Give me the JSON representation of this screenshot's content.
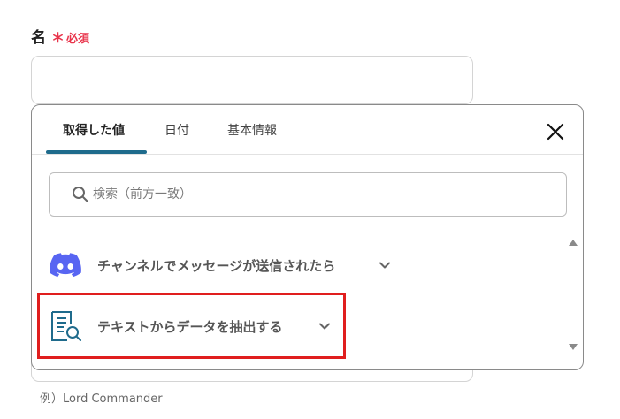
{
  "field": {
    "label": "名",
    "required_star": "＊",
    "required_text": "必須",
    "input_value": ""
  },
  "popup": {
    "tabs": [
      {
        "label": "取得した値",
        "active": true
      },
      {
        "label": "日付",
        "active": false
      },
      {
        "label": "基本情報",
        "active": false
      }
    ],
    "close_icon": "close-icon",
    "search": {
      "placeholder": "検索（前方一致）",
      "value": ""
    },
    "items": [
      {
        "label": "チャンネルでメッセージが送信されたら",
        "icon": "discord-icon",
        "expanded": false
      },
      {
        "label": "テキストからデータを抽出する",
        "icon": "document-search-icon",
        "expanded": false,
        "highlighted": true
      }
    ]
  },
  "example_text": "例）Lord Commander",
  "colors": {
    "required": "#e8334a",
    "tab_indicator": "#1f6b8c",
    "discord": "#5865f2",
    "doc_icon": "#1f6b8c",
    "highlight": "#e01e1e"
  }
}
